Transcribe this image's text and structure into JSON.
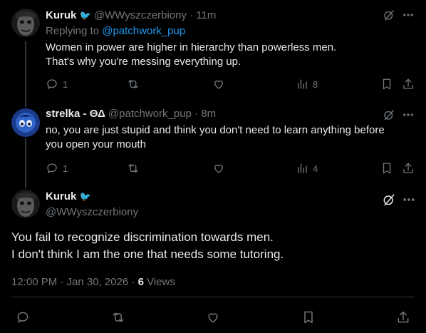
{
  "tweets": [
    {
      "name": "Kuruk",
      "handle": "@WWyszczerbiony",
      "time": "11m",
      "replying_prefix": "Replying to",
      "replying_to": "@patchwork_pup",
      "text1": "Women in power are higher in hierarchy than powerless men.",
      "text2": "That's why you're messing everything up.",
      "replies": "1",
      "views": "8"
    },
    {
      "name": "strelka - ΘΔ",
      "handle": "@patchwork_pup",
      "time": "8m",
      "text1": "no, you are just stupid and think you don't need to learn anything before",
      "text2": "you open your mouth",
      "replies": "1",
      "views": "4"
    }
  ],
  "main": {
    "name": "Kuruk",
    "handle": "@WWyszczerbiony",
    "text1": "You fail to recognize discrimination towards men.",
    "text2": "I don't think I am the one that needs some tutoring.",
    "timestamp": "12:00 PM · Jan 30, 2026 ·",
    "views_count": "6",
    "views_label": "Views"
  },
  "separators": {
    "dot": "·",
    "dash_sep": ""
  },
  "icons": {
    "bird": "crow-emoji-icon",
    "grok": "grok-icon",
    "more": "more-icon",
    "reply": "reply-icon",
    "retweet": "retweet-icon",
    "like": "heart-icon",
    "views": "views-icon",
    "bookmark": "bookmark-icon",
    "share": "share-icon"
  },
  "colors": {
    "accent": "#1d9bf0",
    "muted": "#71767b",
    "text": "#e7e9ea",
    "bg": "#000000"
  }
}
